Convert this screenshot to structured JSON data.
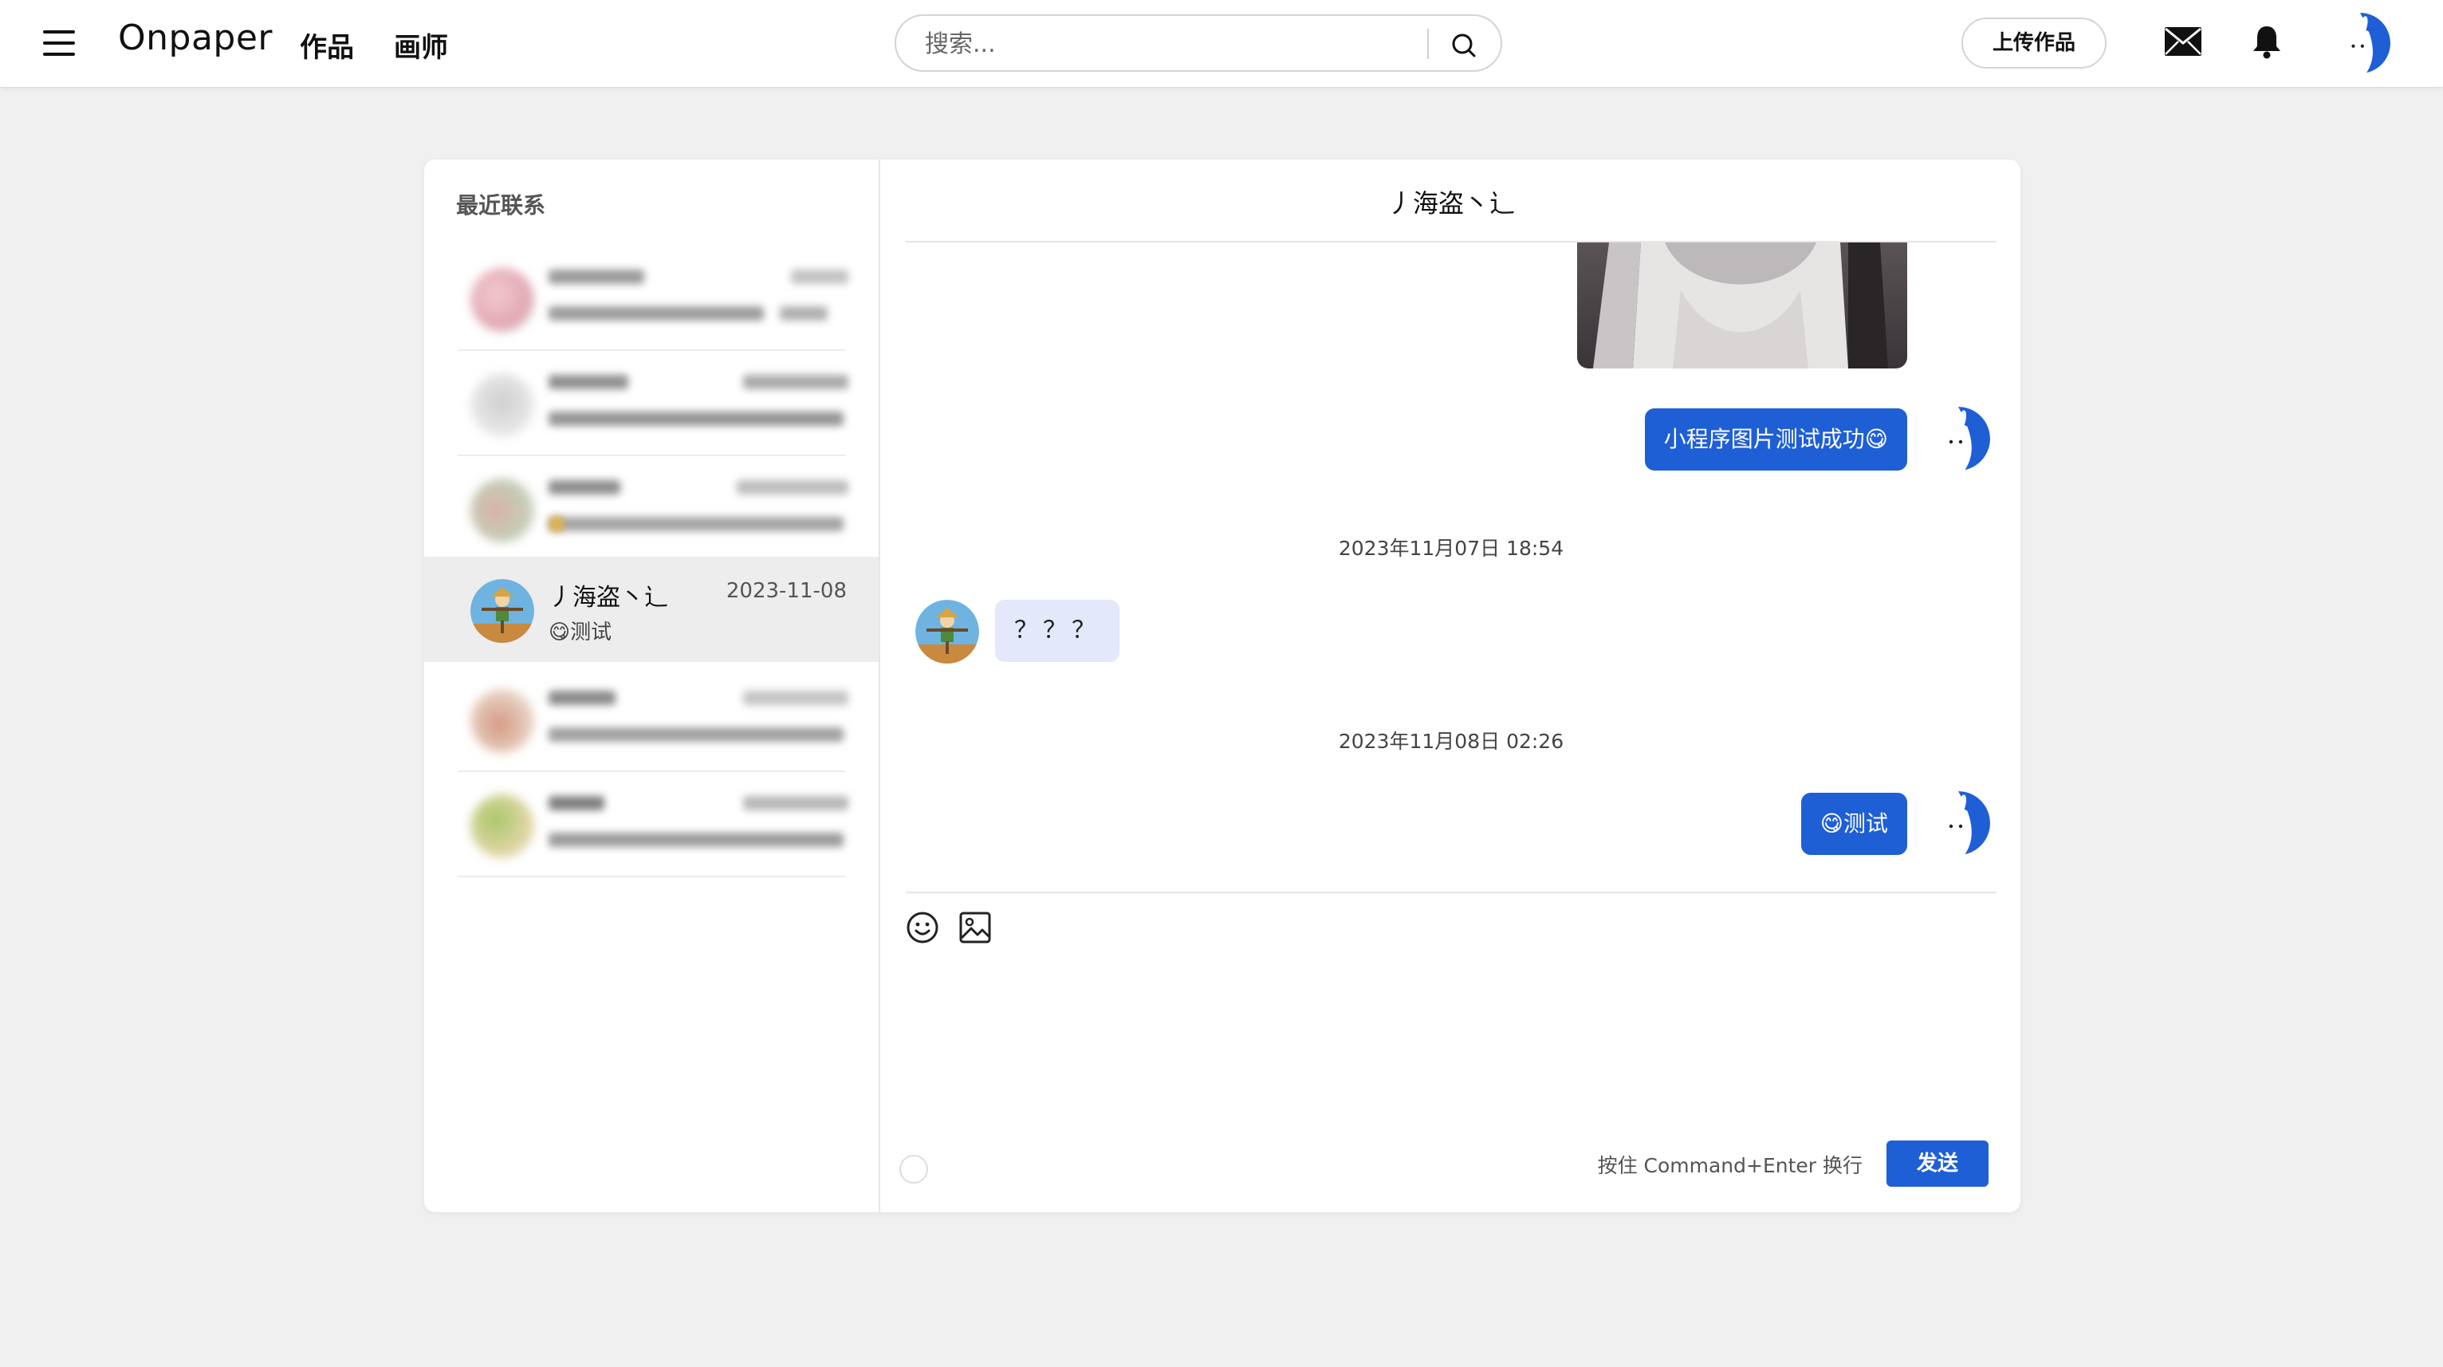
{
  "header": {
    "logo": "Onpaper",
    "nav_works": "作品",
    "nav_artists": "画师",
    "search_placeholder": "搜索...",
    "upload_label": "上传作品"
  },
  "sidebar": {
    "title": "最近联系",
    "active_contact": {
      "name": "丿海盗丶辶",
      "date": "2023-11-08",
      "preview": "😋测试"
    }
  },
  "chat": {
    "title": "丿海盗丶辶",
    "messages": {
      "msg1_text": "小程序图片测试成功😋",
      "ts1": "2023年11月07日 18:54",
      "msg2_text": "？？？",
      "ts2": "2023年11月08日 02:26",
      "msg3_text": "😋测试"
    },
    "hint": "按住 Command+Enter 换行",
    "send_label": "发送"
  },
  "colors": {
    "accent": "#1f5fd6",
    "other_bubble": "#e3e8fb",
    "page_bg": "#f0f0f1"
  }
}
